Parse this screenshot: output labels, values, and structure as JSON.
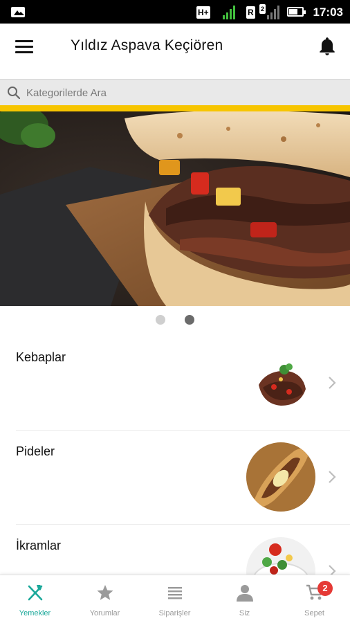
{
  "status_bar": {
    "network_1": "H+",
    "network_2": "R",
    "sim_2_label": "2",
    "time": "17:03"
  },
  "app_bar": {
    "title": "Yıldız Aspava Keçiören",
    "menu_icon": "hamburger-menu-icon",
    "notification_icon": "bell-icon"
  },
  "search": {
    "placeholder": "Kategorilerde Ara",
    "value": ""
  },
  "banner": {
    "slide_count": 2,
    "active_slide": 2
  },
  "categories": [
    {
      "label": "Kebaplar"
    },
    {
      "label": "Pideler"
    },
    {
      "label": "İkramlar"
    }
  ],
  "bottom_nav": {
    "items": [
      {
        "label": "Yemekler",
        "icon": "fork-knife-icon",
        "active": true
      },
      {
        "label": "Yorumlar",
        "icon": "star-icon",
        "active": false
      },
      {
        "label": "Siparişler",
        "icon": "list-icon",
        "active": false
      },
      {
        "label": "Siz",
        "icon": "person-icon",
        "active": false
      },
      {
        "label": "Sepet",
        "icon": "cart-icon",
        "active": false,
        "badge": "2"
      }
    ]
  },
  "colors": {
    "accent": "#1aa89a",
    "strip": "#f7c500",
    "badge": "#e53935"
  }
}
